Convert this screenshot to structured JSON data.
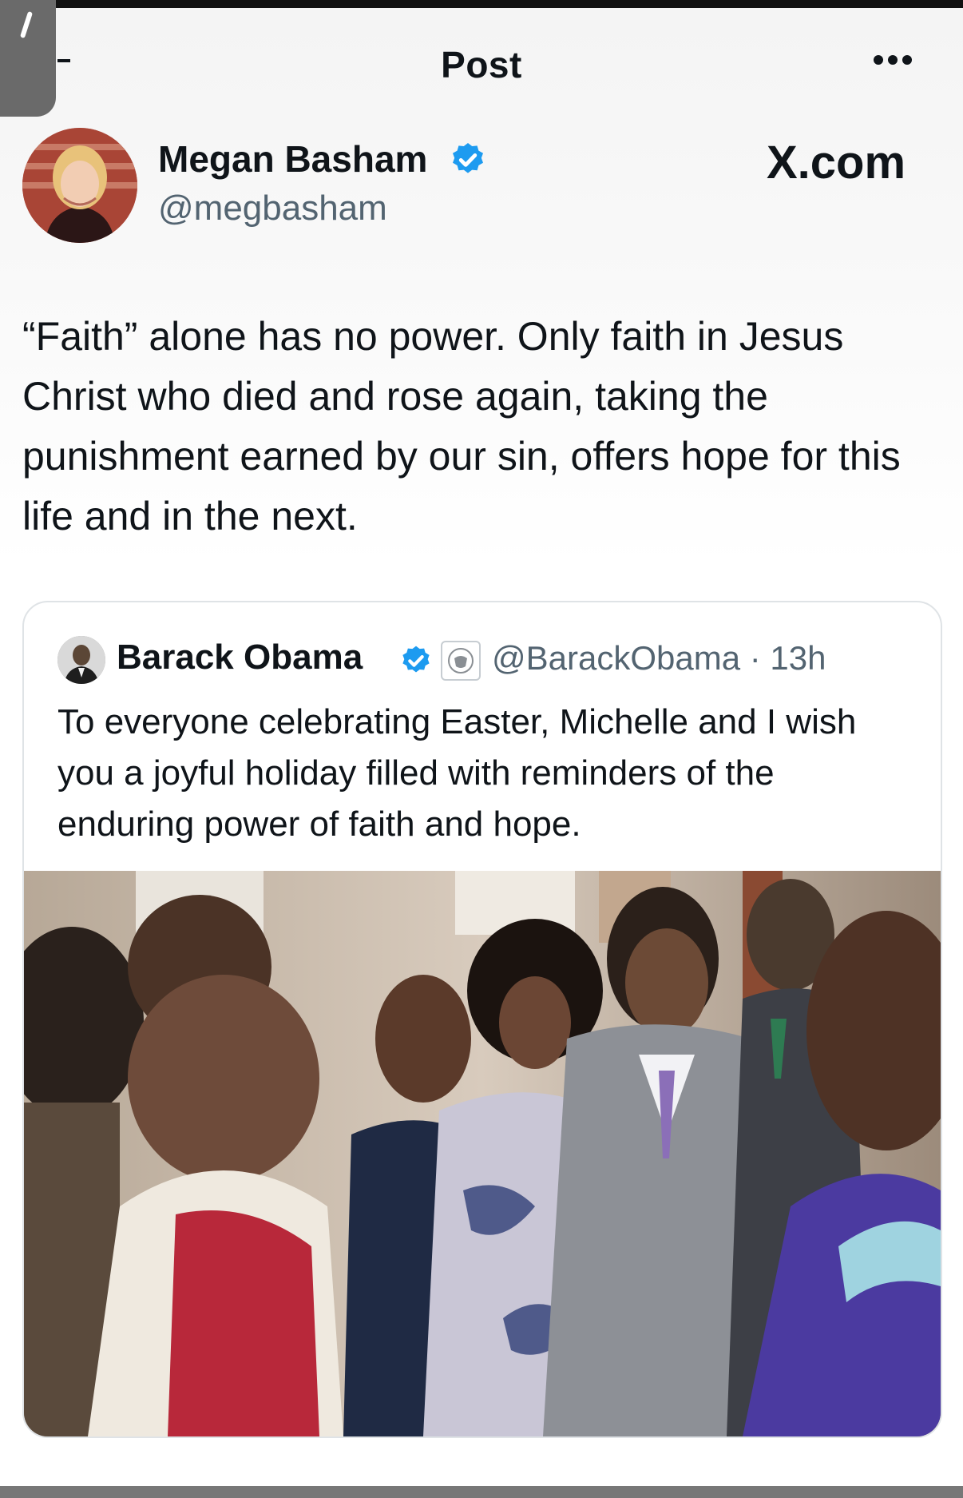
{
  "nav": {
    "title": "Post",
    "more_icon": "more-horizontal-icon"
  },
  "author": {
    "name": "Megan Basham",
    "handle": "@megbasham",
    "verified_icon": "verified-badge-icon",
    "verified_color": "#1d9bf0"
  },
  "brand": "X.com",
  "post": {
    "text": "“Faith” alone has no power. Only faith in Jesus Christ who died and rose again, taking the punishment earned by our sin, offers hope for this life and in the next."
  },
  "quoted_post": {
    "name": "Barack Obama",
    "handle_time": "@BarackObama · 13h",
    "text": "To everyone celebrating Easter, Michelle and I wish you a joyful holiday filled with reminders of the enduring power of faith and hope.",
    "verified_icon": "verified-badge-icon",
    "affiliation_icon": "government-seal-icon"
  },
  "colors": {
    "text": "#0f1419",
    "secondary": "#536471",
    "border": "#dfe3e6",
    "verified": "#1d9bf0"
  }
}
